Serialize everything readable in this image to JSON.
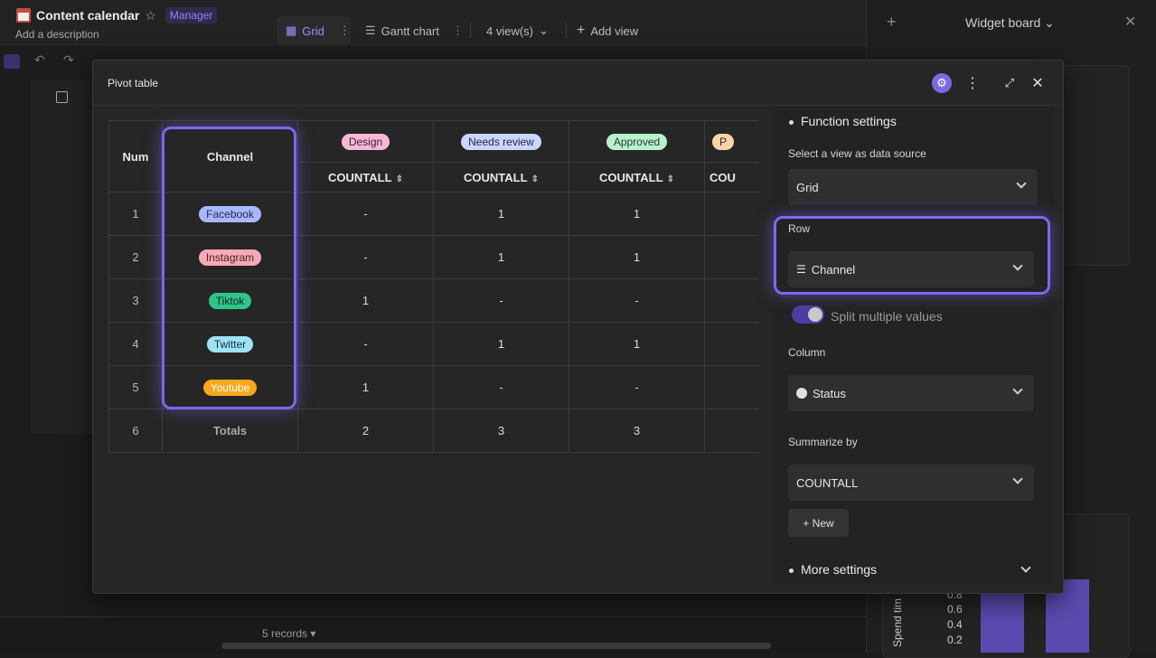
{
  "app": {
    "title": "Content calendar",
    "role_badge": "Manager",
    "description": "Add a description",
    "tabs": [
      {
        "label": "Grid"
      },
      {
        "label": "Gantt chart"
      },
      {
        "label": "4 view(s)"
      },
      {
        "label": "Add view"
      }
    ],
    "records": "5 records"
  },
  "widget_board": {
    "title": "Widget board",
    "chart": {
      "ylabel": "Spend tim",
      "yticks": [
        "0.8",
        "0.6",
        "0.4",
        "0.2"
      ]
    }
  },
  "modal": {
    "title": "Pivot table",
    "table": {
      "header_num": "Num",
      "header_channel": "Channel",
      "columns": [
        {
          "status": "Design",
          "color": "#f6b8d8",
          "summary": "COUNTALL"
        },
        {
          "status": "Needs review",
          "color": "#c9d6ff",
          "summary": "COUNTALL"
        },
        {
          "status": "Approved",
          "color": "#b9f0cf",
          "summary": "COUNTALL"
        },
        {
          "status": "P",
          "color": "#fbd3a8",
          "summary": "COU"
        }
      ],
      "rows": [
        {
          "num": "1",
          "channel": "Facebook",
          "color": "#aab7ff",
          "values": [
            "-",
            "1",
            "1"
          ]
        },
        {
          "num": "2",
          "channel": "Instagram",
          "color": "#f7a9b5",
          "values": [
            "-",
            "1",
            "1"
          ]
        },
        {
          "num": "3",
          "channel": "Tiktok",
          "color": "#2fc58a",
          "values": [
            "1",
            "-",
            "-"
          ]
        },
        {
          "num": "4",
          "channel": "Twitter",
          "color": "#9fe2f6",
          "values": [
            "-",
            "1",
            "1"
          ]
        },
        {
          "num": "5",
          "channel": "Youtube",
          "color": "#f7a81b",
          "values": [
            "1",
            "-",
            "-"
          ]
        }
      ],
      "totals": {
        "num": "6",
        "label": "Totals",
        "values": [
          "2",
          "3",
          "3"
        ]
      }
    },
    "settings": {
      "function_settings": "Function settings",
      "data_source_label": "Select a view as data source",
      "data_source_value": "Grid",
      "row_label": "Row",
      "row_value": "Channel",
      "split_label": "Split multiple values",
      "column_label": "Column",
      "column_value": "Status",
      "summarize_label": "Summarize by",
      "summarize_value": "COUNTALL",
      "new_button": "+ New",
      "more_settings": "More settings"
    }
  }
}
